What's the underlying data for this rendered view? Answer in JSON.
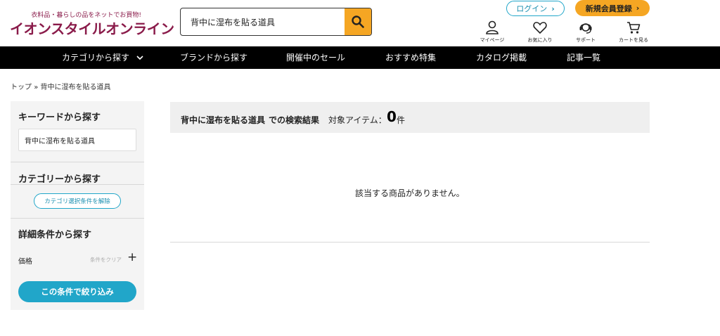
{
  "header": {
    "logo_tagline": "衣料品・暮らしの品をネットでお買物!",
    "logo_text": "イオンスタイルオンライン",
    "search": {
      "value": "背中に湿布を貼る道具"
    },
    "login_label": "ログイン",
    "register_label": "新規会員登録",
    "icons": [
      {
        "label": "マイページ",
        "icon": "person-icon"
      },
      {
        "label": "お気に入り",
        "icon": "heart-icon"
      },
      {
        "label": "サポート",
        "icon": "headset-icon"
      },
      {
        "label": "カートを見る",
        "icon": "cart-icon"
      }
    ]
  },
  "nav": {
    "items": [
      {
        "label": "カテゴリから探す"
      },
      {
        "label": "ブランドから探す"
      },
      {
        "label": "開催中のセール"
      },
      {
        "label": "おすすめ特集"
      },
      {
        "label": "カタログ掲載"
      },
      {
        "label": "記事一覧"
      }
    ]
  },
  "breadcrumb": {
    "home": "トップ",
    "separator": "»",
    "current": "背中に湿布を貼る道具"
  },
  "sidebar": {
    "keyword_heading": "キーワードから探す",
    "keyword_value": "背中に湿布を貼る道具",
    "category_heading": "カテゴリーから探す",
    "clear_category_label": "カテゴリ選択条件を解除",
    "detail_heading": "詳細条件から探す",
    "price_label": "価格",
    "clear_conditions_label": "条件をクリア",
    "plus": "+",
    "submit_label": "この条件で絞り込み"
  },
  "results": {
    "query": "背中に湿布を貼る道具",
    "suffix": "での検索結果",
    "count_label": "対象アイテム：",
    "count": "0",
    "unit": "件",
    "empty_message": "該当する商品がありません。"
  },
  "colors": {
    "brand": "#8a1b4a",
    "accent_orange": "#f5a623",
    "accent_blue": "#21a6c9",
    "nav_bg": "#000000"
  }
}
